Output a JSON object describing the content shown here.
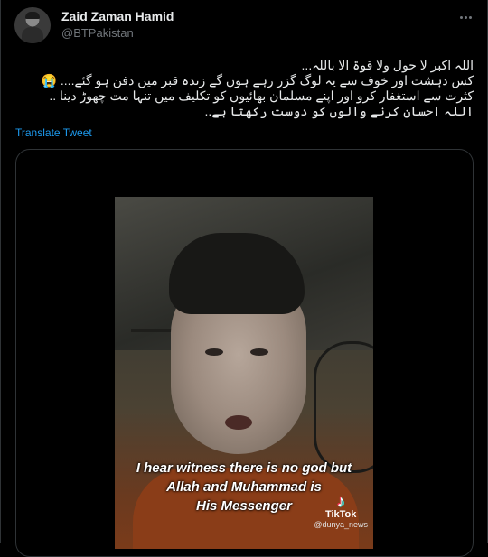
{
  "author": {
    "name": "Zaid Zaman Hamid",
    "handle": "@BTPakistan"
  },
  "tweet": {
    "lines": [
      "اللہ اکبر لا حول ولا قوۃ الا باللہ...",
      "کس دہشت اور خوف سے یہ لوگ گزر رہے ہوں گے زندہ قبر میں دفن ہو گئے.... 😭",
      "کثرت سے استغفار کرو اور اپنے مسلمان بھائیوں کو تکلیف میں تنہا مت چھوڑ دینا ..",
      "اللہ احسان کرنے والوں کو دوست رکھتا ہے.."
    ],
    "translate_label": "Translate Tweet"
  },
  "media": {
    "caption_lines": [
      "I hear witness there is no god but",
      "Allah and Muhammad is",
      "His Messenger"
    ],
    "watermark": {
      "icon": "tiktok-logo-icon",
      "brand": "TikTok",
      "user": "@dunya_news"
    }
  },
  "colors": {
    "background": "#000000",
    "text": "#e7e9ea",
    "secondary": "#71767b",
    "link": "#1d9bf0",
    "border": "#2f3336"
  }
}
